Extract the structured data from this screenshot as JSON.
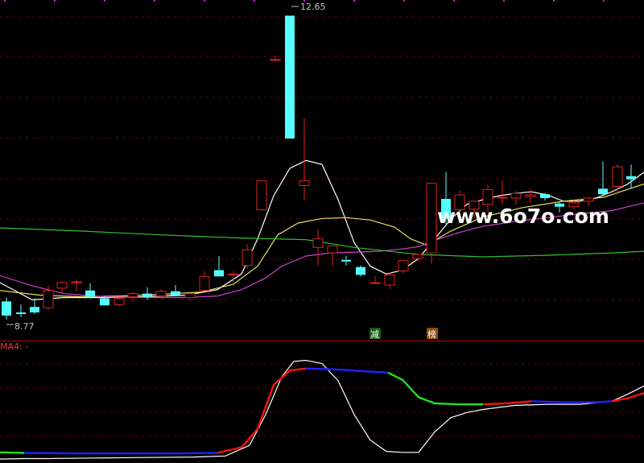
{
  "chart_data": {
    "type": "candlestick",
    "price_axis": {
      "ylim": [
        8.5,
        12.85
      ]
    },
    "annotations": {
      "high_label": "12.65",
      "low_label": "8.77"
    },
    "badges": [
      "减",
      "榜"
    ],
    "watermark": "www.6o7o.com",
    "indicator_label": "MA4: -",
    "colors": {
      "background": "#000000",
      "up": "#e02020",
      "down": "#55ffff",
      "grid": "#7a0000",
      "separator": "#c00000",
      "ma_white": "#ffffff",
      "ma_yellow": "#e8e060",
      "ma_magenta": "#d040d0",
      "ma_green": "#30c030",
      "ind_green": "#20e020",
      "ind_blue": "#2020ff",
      "ind_red": "#ff1010"
    },
    "candles": [
      {
        "x": 8,
        "o": 9.0,
        "h": 9.05,
        "l": 8.77,
        "c": 8.82
      },
      {
        "x": 26,
        "o": 8.86,
        "h": 8.96,
        "l": 8.8,
        "c": 8.84
      },
      {
        "x": 43,
        "o": 8.93,
        "h": 9.04,
        "l": 8.84,
        "c": 8.86
      },
      {
        "x": 60,
        "o": 8.92,
        "h": 9.2,
        "l": 8.89,
        "c": 9.14
      },
      {
        "x": 77,
        "o": 9.17,
        "h": 9.26,
        "l": 9.11,
        "c": 9.24
      },
      {
        "x": 95,
        "o": 9.25,
        "h": 9.28,
        "l": 9.13,
        "c": 9.25
      },
      {
        "x": 112,
        "o": 9.14,
        "h": 9.23,
        "l": 9.04,
        "c": 9.06
      },
      {
        "x": 130,
        "o": 9.04,
        "h": 9.07,
        "l": 8.95,
        "c": 8.95
      },
      {
        "x": 148,
        "o": 8.96,
        "h": 9.04,
        "l": 8.94,
        "c": 9.04
      },
      {
        "x": 165,
        "o": 9.06,
        "h": 9.12,
        "l": 9.0,
        "c": 9.1
      },
      {
        "x": 183,
        "o": 9.1,
        "h": 9.18,
        "l": 9.02,
        "c": 9.06
      },
      {
        "x": 200,
        "o": 9.07,
        "h": 9.16,
        "l": 9.04,
        "c": 9.13
      },
      {
        "x": 218,
        "o": 9.13,
        "h": 9.21,
        "l": 9.1,
        "c": 9.08
      },
      {
        "x": 236,
        "o": 9.05,
        "h": 9.13,
        "l": 9.01,
        "c": 9.1
      },
      {
        "x": 254,
        "o": 9.14,
        "h": 9.39,
        "l": 9.14,
        "c": 9.32
      },
      {
        "x": 272,
        "o": 9.4,
        "h": 9.58,
        "l": 9.36,
        "c": 9.32
      },
      {
        "x": 290,
        "o": 9.35,
        "h": 9.39,
        "l": 9.24,
        "c": 9.35
      },
      {
        "x": 307,
        "o": 9.46,
        "h": 9.73,
        "l": 9.42,
        "c": 9.66
      },
      {
        "x": 325,
        "o": 10.17,
        "h": 10.55,
        "l": 10.16,
        "c": 10.54
      },
      {
        "x": 342,
        "o": 12.08,
        "h": 12.14,
        "l": 12.08,
        "c": 12.09
      },
      {
        "x": 360,
        "o": 12.65,
        "h": 12.65,
        "l": 11.08,
        "c": 11.08
      },
      {
        "x": 378,
        "o": 10.48,
        "h": 11.34,
        "l": 10.29,
        "c": 10.54
      },
      {
        "x": 395,
        "o": 9.69,
        "h": 9.92,
        "l": 9.46,
        "c": 9.8
      },
      {
        "x": 413,
        "o": 9.62,
        "h": 9.68,
        "l": 9.46,
        "c": 9.71
      },
      {
        "x": 430,
        "o": 9.53,
        "h": 9.58,
        "l": 9.46,
        "c": 9.51
      },
      {
        "x": 448,
        "o": 9.44,
        "h": 9.46,
        "l": 9.32,
        "c": 9.34
      },
      {
        "x": 466,
        "o": 9.24,
        "h": 9.32,
        "l": 9.22,
        "c": 9.24
      },
      {
        "x": 484,
        "o": 9.21,
        "h": 9.37,
        "l": 9.16,
        "c": 9.34
      },
      {
        "x": 501,
        "o": 9.39,
        "h": 9.53,
        "l": 9.36,
        "c": 9.52
      },
      {
        "x": 519,
        "o": 9.55,
        "h": 9.61,
        "l": 9.51,
        "c": 9.6
      },
      {
        "x": 536,
        "o": 9.62,
        "h": 10.47,
        "l": 9.48,
        "c": 10.51
      },
      {
        "x": 554,
        "o": 10.31,
        "h": 10.65,
        "l": 9.99,
        "c": 10.06
      },
      {
        "x": 571,
        "o": 10.17,
        "h": 10.42,
        "l": 10.14,
        "c": 10.36
      },
      {
        "x": 589,
        "o": 10.18,
        "h": 10.29,
        "l": 10.06,
        "c": 10.28
      },
      {
        "x": 606,
        "o": 10.24,
        "h": 10.49,
        "l": 10.14,
        "c": 10.43
      },
      {
        "x": 624,
        "o": 10.33,
        "h": 10.54,
        "l": 10.24,
        "c": 10.33
      },
      {
        "x": 641,
        "o": 10.32,
        "h": 10.41,
        "l": 10.24,
        "c": 10.38
      },
      {
        "x": 659,
        "o": 10.34,
        "h": 10.44,
        "l": 10.26,
        "c": 10.36
      },
      {
        "x": 677,
        "o": 10.37,
        "h": 10.38,
        "l": 10.29,
        "c": 10.32
      },
      {
        "x": 695,
        "o": 10.25,
        "h": 10.27,
        "l": 10.14,
        "c": 10.21
      },
      {
        "x": 713,
        "o": 10.21,
        "h": 10.3,
        "l": 10.18,
        "c": 10.26
      },
      {
        "x": 731,
        "o": 10.28,
        "h": 10.34,
        "l": 10.22,
        "c": 10.32
      },
      {
        "x": 749,
        "o": 10.44,
        "h": 10.79,
        "l": 10.36,
        "c": 10.37
      },
      {
        "x": 767,
        "o": 10.47,
        "h": 10.75,
        "l": 10.36,
        "c": 10.72
      },
      {
        "x": 784,
        "o": 10.6,
        "h": 10.75,
        "l": 10.44,
        "c": 10.56
      }
    ],
    "ma_lines": [
      {
        "color_key": "ma_white",
        "points": [
          [
            0,
            9.24
          ],
          [
            40,
            9.02
          ],
          [
            80,
            9.05
          ],
          [
            130,
            9.05
          ],
          [
            180,
            9.06
          ],
          [
            230,
            9.08
          ],
          [
            270,
            9.15
          ],
          [
            300,
            9.35
          ],
          [
            320,
            9.8
          ],
          [
            340,
            10.35
          ],
          [
            360,
            10.7
          ],
          [
            380,
            10.8
          ],
          [
            400,
            10.75
          ],
          [
            420,
            10.3
          ],
          [
            440,
            9.75
          ],
          [
            460,
            9.45
          ],
          [
            480,
            9.35
          ],
          [
            500,
            9.4
          ],
          [
            520,
            9.55
          ],
          [
            540,
            9.8
          ],
          [
            560,
            10.05
          ],
          [
            580,
            10.24
          ],
          [
            600,
            10.3
          ],
          [
            620,
            10.35
          ],
          [
            640,
            10.38
          ],
          [
            660,
            10.4
          ],
          [
            680,
            10.36
          ],
          [
            700,
            10.28
          ],
          [
            720,
            10.28
          ],
          [
            740,
            10.32
          ],
          [
            760,
            10.4
          ],
          [
            780,
            10.5
          ],
          [
            800,
            10.65
          ]
        ]
      },
      {
        "color_key": "ma_yellow",
        "points": [
          [
            0,
            9.14
          ],
          [
            50,
            9.08
          ],
          [
            100,
            9.06
          ],
          [
            150,
            9.07
          ],
          [
            200,
            9.09
          ],
          [
            250,
            9.12
          ],
          [
            290,
            9.22
          ],
          [
            320,
            9.45
          ],
          [
            345,
            9.85
          ],
          [
            370,
            10.0
          ],
          [
            400,
            10.06
          ],
          [
            430,
            10.07
          ],
          [
            460,
            10.04
          ],
          [
            490,
            9.95
          ],
          [
            510,
            9.8
          ],
          [
            530,
            9.72
          ],
          [
            560,
            9.9
          ],
          [
            600,
            10.08
          ],
          [
            650,
            10.2
          ],
          [
            700,
            10.28
          ],
          [
            750,
            10.33
          ],
          [
            800,
            10.5
          ]
        ]
      },
      {
        "color_key": "ma_magenta",
        "points": [
          [
            0,
            9.33
          ],
          [
            40,
            9.2
          ],
          [
            80,
            9.1
          ],
          [
            130,
            9.06
          ],
          [
            180,
            9.05
          ],
          [
            230,
            9.05
          ],
          [
            270,
            9.07
          ],
          [
            300,
            9.15
          ],
          [
            330,
            9.3
          ],
          [
            350,
            9.45
          ],
          [
            380,
            9.58
          ],
          [
            410,
            9.62
          ],
          [
            440,
            9.63
          ],
          [
            470,
            9.64
          ],
          [
            500,
            9.67
          ],
          [
            520,
            9.7
          ],
          [
            540,
            9.78
          ],
          [
            570,
            9.88
          ],
          [
            600,
            9.96
          ],
          [
            640,
            10.02
          ],
          [
            680,
            10.07
          ],
          [
            720,
            10.12
          ],
          [
            760,
            10.16
          ],
          [
            800,
            10.26
          ]
        ]
      },
      {
        "color_key": "ma_green",
        "points": [
          [
            0,
            9.94
          ],
          [
            100,
            9.9
          ],
          [
            200,
            9.85
          ],
          [
            300,
            9.81
          ],
          [
            380,
            9.79
          ],
          [
            440,
            9.69
          ],
          [
            520,
            9.6
          ],
          [
            600,
            9.57
          ],
          [
            680,
            9.59
          ],
          [
            760,
            9.62
          ],
          [
            800,
            9.64
          ]
        ]
      }
    ],
    "indicator": {
      "ylim": [
        0,
        1
      ],
      "white": [
        [
          0,
          0.015
        ],
        [
          30,
          0.02
        ],
        [
          60,
          0.02
        ],
        [
          120,
          0.025
        ],
        [
          180,
          0.03
        ],
        [
          240,
          0.035
        ],
        [
          280,
          0.045
        ],
        [
          310,
          0.15
        ],
        [
          330,
          0.45
        ],
        [
          350,
          0.82
        ],
        [
          365,
          0.97
        ],
        [
          380,
          0.98
        ],
        [
          400,
          0.95
        ],
        [
          420,
          0.78
        ],
        [
          440,
          0.45
        ],
        [
          460,
          0.2
        ],
        [
          480,
          0.09
        ],
        [
          500,
          0.08
        ],
        [
          520,
          0.08
        ],
        [
          540,
          0.28
        ],
        [
          560,
          0.42
        ],
        [
          580,
          0.47
        ],
        [
          600,
          0.5
        ],
        [
          640,
          0.54
        ],
        [
          680,
          0.55
        ],
        [
          720,
          0.55
        ],
        [
          760,
          0.58
        ],
        [
          780,
          0.65
        ],
        [
          800,
          0.73
        ]
      ],
      "colored": [
        {
          "color_key": "ind_green",
          "points": [
            [
              0,
              0.08
            ],
            [
              30,
              0.075
            ]
          ]
        },
        {
          "color_key": "ind_blue",
          "points": [
            [
              30,
              0.075
            ],
            [
              100,
              0.07
            ],
            [
              160,
              0.07
            ],
            [
              220,
              0.07
            ],
            [
              270,
              0.075
            ]
          ]
        },
        {
          "color_key": "ind_red",
          "points": [
            [
              270,
              0.075
            ],
            [
              300,
              0.13
            ],
            [
              320,
              0.31
            ],
            [
              340,
              0.74
            ],
            [
              360,
              0.88
            ],
            [
              380,
              0.9
            ]
          ]
        },
        {
          "color_key": "ind_blue",
          "points": [
            [
              380,
              0.9
            ],
            [
              420,
              0.89
            ],
            [
              460,
              0.87
            ],
            [
              482,
              0.86
            ]
          ]
        },
        {
          "color_key": "ind_green",
          "points": [
            [
              482,
              0.86
            ],
            [
              500,
              0.79
            ],
            [
              520,
              0.62
            ],
            [
              540,
              0.56
            ],
            [
              570,
              0.55
            ],
            [
              600,
              0.55
            ]
          ]
        },
        {
          "color_key": "ind_red",
          "points": [
            [
              600,
              0.55
            ],
            [
              630,
              0.56
            ],
            [
              660,
              0.58
            ]
          ]
        },
        {
          "color_key": "ind_blue",
          "points": [
            [
              660,
              0.58
            ],
            [
              700,
              0.57
            ],
            [
              740,
              0.57
            ],
            [
              760,
              0.58
            ]
          ]
        },
        {
          "color_key": "ind_red",
          "points": [
            [
              760,
              0.58
            ],
            [
              780,
              0.61
            ],
            [
              800,
              0.66
            ]
          ]
        }
      ]
    }
  }
}
